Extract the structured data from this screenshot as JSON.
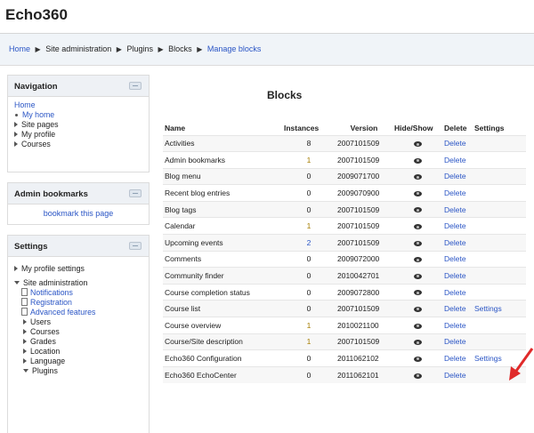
{
  "site": {
    "title": "Echo360"
  },
  "breadcrumb": [
    {
      "label": "Home",
      "link": true
    },
    {
      "label": "Site administration",
      "link": false
    },
    {
      "label": "Plugins",
      "link": false
    },
    {
      "label": "Blocks",
      "link": false
    },
    {
      "label": "Manage blocks",
      "link": true
    }
  ],
  "navigation": {
    "title": "Navigation",
    "home": "Home",
    "my_home": "My home",
    "items": [
      "Site pages",
      "My profile",
      "Courses"
    ]
  },
  "admin_bookmarks": {
    "title": "Admin bookmarks",
    "link": "bookmark this page"
  },
  "settings": {
    "title": "Settings",
    "profile": "My profile settings",
    "site_admin": "Site administration",
    "sub": [
      "Notifications",
      "Registration",
      "Advanced features"
    ],
    "expand": [
      "Users",
      "Courses",
      "Grades",
      "Location",
      "Language"
    ],
    "plugins": "Plugins"
  },
  "main": {
    "title": "Blocks",
    "columns": [
      "Name",
      "Instances",
      "Version",
      "Hide/Show",
      "Delete",
      "Settings"
    ],
    "rows": [
      {
        "name": "Activities",
        "instances": "8",
        "version": "2007101509",
        "delete": "Delete",
        "settings": ""
      },
      {
        "name": "Admin bookmarks",
        "instances": "1",
        "version": "2007101509",
        "delete": "Delete",
        "settings": ""
      },
      {
        "name": "Blog menu",
        "instances": "0",
        "version": "2009071700",
        "delete": "Delete",
        "settings": ""
      },
      {
        "name": "Recent blog entries",
        "instances": "0",
        "version": "2009070900",
        "delete": "Delete",
        "settings": ""
      },
      {
        "name": "Blog tags",
        "instances": "0",
        "version": "2007101509",
        "delete": "Delete",
        "settings": ""
      },
      {
        "name": "Calendar",
        "instances": "1",
        "version": "2007101509",
        "delete": "Delete",
        "settings": ""
      },
      {
        "name": "Upcoming events",
        "instances": "2",
        "version": "2007101509",
        "delete": "Delete",
        "settings": ""
      },
      {
        "name": "Comments",
        "instances": "0",
        "version": "2009072000",
        "delete": "Delete",
        "settings": ""
      },
      {
        "name": "Community finder",
        "instances": "0",
        "version": "2010042701",
        "delete": "Delete",
        "settings": ""
      },
      {
        "name": "Course completion status",
        "instances": "0",
        "version": "2009072800",
        "delete": "Delete",
        "settings": ""
      },
      {
        "name": "Course list",
        "instances": "0",
        "version": "2007101509",
        "delete": "Delete",
        "settings": "Settings"
      },
      {
        "name": "Course overview",
        "instances": "1",
        "version": "2010021100",
        "delete": "Delete",
        "settings": ""
      },
      {
        "name": "Course/Site description",
        "instances": "1",
        "version": "2007101509",
        "delete": "Delete",
        "settings": ""
      },
      {
        "name": "Echo360 Configuration",
        "instances": "0",
        "version": "2011062102",
        "delete": "Delete",
        "settings": "Settings"
      },
      {
        "name": "Echo360 EchoCenter",
        "instances": "0",
        "version": "2011062101",
        "delete": "Delete",
        "settings": ""
      }
    ]
  },
  "colors": {
    "link": "#2a55c5",
    "arrow": "#e02a2a",
    "header_bg": "#f0f4f8"
  }
}
